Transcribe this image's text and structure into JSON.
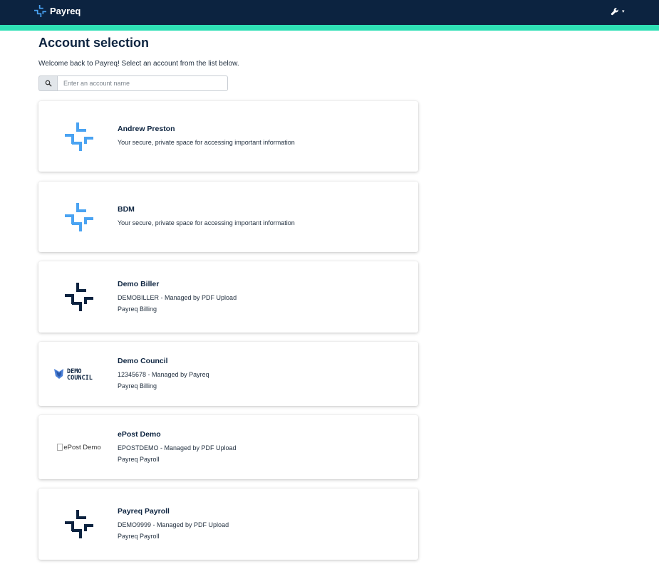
{
  "header": {
    "brand_name": "Payreq",
    "settings_icon": "wrench-icon",
    "colors": {
      "navbar": "#0c2340",
      "accent_strip": "#2fe0b5"
    }
  },
  "page": {
    "title": "Account selection",
    "welcome": "Welcome back to Payreq! Select an account from the list below."
  },
  "search": {
    "icon": "search-icon",
    "placeholder": "Enter an account name",
    "value": ""
  },
  "accounts": [
    {
      "name": "Andrew Preston",
      "line1": "Your secure, private space for accessing important information",
      "line2": "",
      "logo": "payreq-logo-blue"
    },
    {
      "name": "BDM",
      "line1": "Your secure, private space for accessing important information",
      "line2": "",
      "logo": "payreq-logo-blue"
    },
    {
      "name": "Demo Biller",
      "line1": "DEMOBILLER - Managed by PDF Upload",
      "line2": "Payreq Billing",
      "logo": "payreq-logo-navy"
    },
    {
      "name": "Demo Council",
      "line1": "12345678 - Managed by Payreq",
      "line2": "Payreq Billing",
      "logo": "demo-council-logo",
      "logo_text_1": "DEMO",
      "logo_text_2": "COUNCIL"
    },
    {
      "name": "ePost Demo",
      "line1": "EPOSTDEMO - Managed by PDF Upload",
      "line2": "Payreq Payroll",
      "logo": "broken-image",
      "logo_alt": "ePost Demo"
    },
    {
      "name": "Payreq Payroll",
      "line1": "DEMO9999 - Managed by PDF Upload",
      "line2": "Payreq Payroll",
      "logo": "payreq-logo-navy"
    }
  ]
}
